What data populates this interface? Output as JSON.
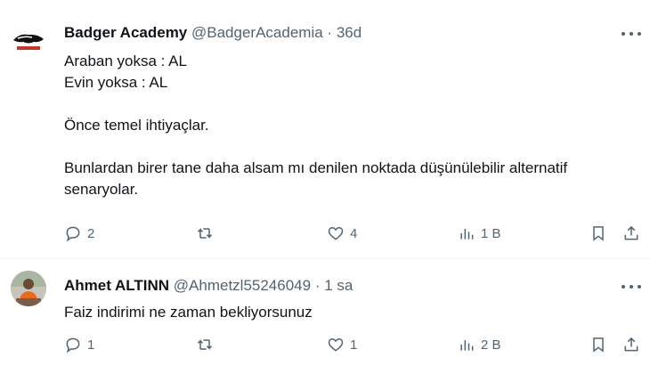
{
  "tweets": [
    {
      "name": "Badger Academy",
      "handle": "@BadgerAcademia",
      "sep": "·",
      "time": "36d",
      "lines": [
        "Araban yoksa : AL",
        "Evin yoksa : AL",
        "",
        "Önce temel ihtiyaçlar.",
        "",
        "Bunlardan birer tane daha alsam mı denilen noktada düşünülebilir alternatif senaryolar."
      ],
      "avatar_text": "BADGER ACADEMY",
      "actions": {
        "replies": "2",
        "retweets": "",
        "likes": "4",
        "views": "1 B"
      }
    },
    {
      "name": "Ahmet ALTINN",
      "handle": "@Ahmetzl55246049",
      "sep": "·",
      "time": "1 sa",
      "lines": [
        "Faiz indirimi ne zaman bekliyorsunuz"
      ],
      "actions": {
        "replies": "1",
        "retweets": "",
        "likes": "1",
        "views": "2 B"
      }
    }
  ],
  "icons": {
    "reply": "reply-icon",
    "retweet": "retweet-icon",
    "like": "heart-icon",
    "views": "views-icon",
    "bookmark": "bookmark-icon",
    "share": "share-icon",
    "more": "more-icon"
  }
}
